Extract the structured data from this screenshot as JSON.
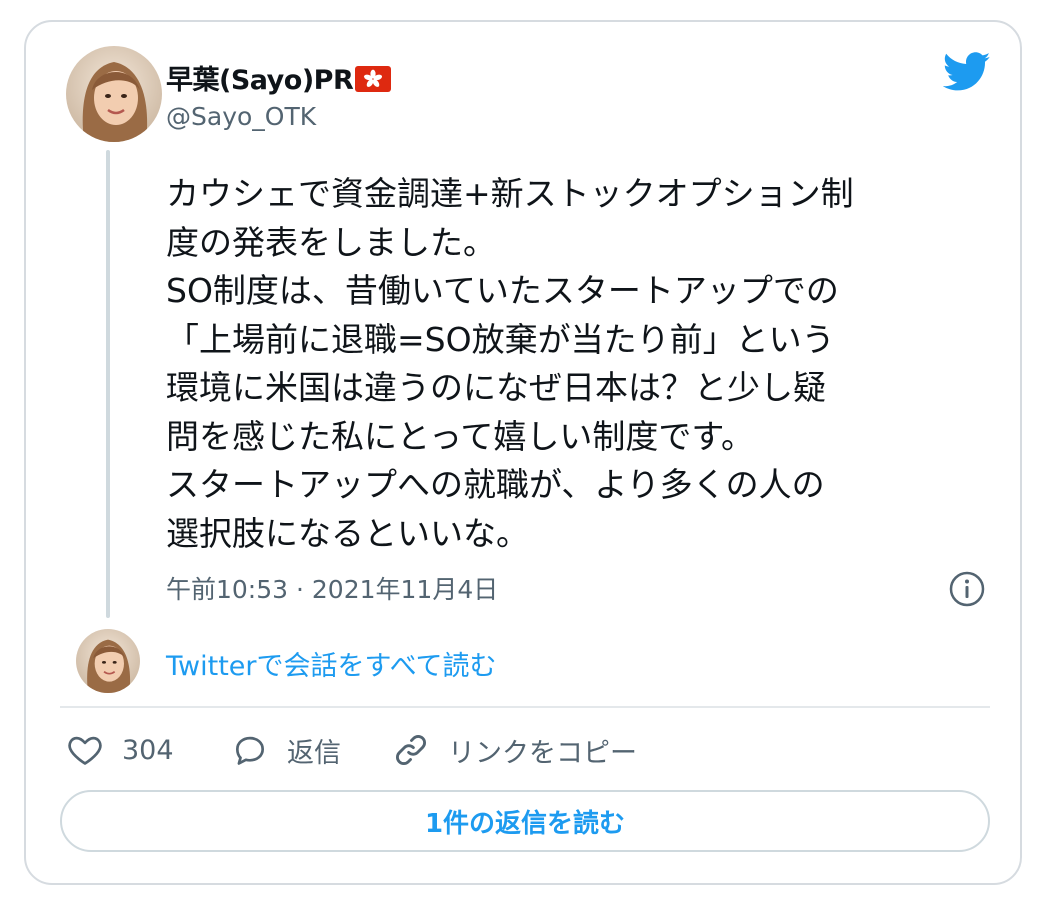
{
  "colors": {
    "accent": "#1d9bf0",
    "text_primary": "#0f1419",
    "text_secondary": "#536471",
    "border": "#cfd9de",
    "flag_red": "#de2910"
  },
  "author": {
    "display_name": "早葉(Sayo)PR",
    "flag_icon": "hong-kong-flag-icon",
    "username": "@Sayo_OTK"
  },
  "brand_icon": "twitter-bird-icon",
  "tweet": {
    "lines": [
      "カウシェで資金調達+新ストックオプション制",
      "度の発表をしました。",
      "SO制度は、昔働いていたスタートアップでの",
      "「上場前に退職=SO放棄が当たり前」という",
      "環境に米国は違うのになぜ日本は？と少し疑",
      "問を感じた私にとって嬉しい制度です。",
      "スタートアップへの就職が、より多くの人の",
      "選択肢になるといいな。"
    ],
    "timestamp": "午前10:53 · 2021年11月4日"
  },
  "conversation": {
    "link_label": "Twitterで会話をすべて読む"
  },
  "actions": {
    "like_count": "304",
    "reply_label": "返信",
    "copy_link_label": "リンクをコピー"
  },
  "replies_button_label": "1件の返信を読む"
}
